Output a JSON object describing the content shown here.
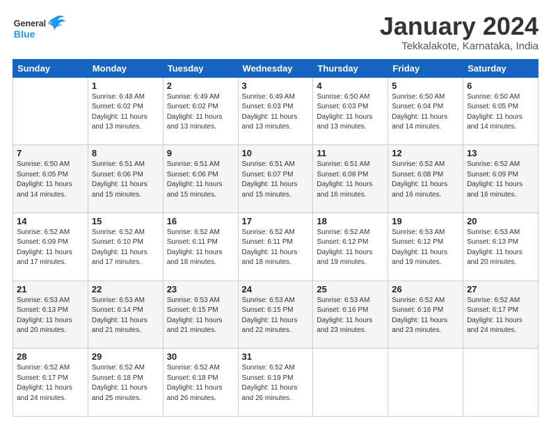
{
  "header": {
    "logo_general": "General",
    "logo_blue": "Blue",
    "month_title": "January 2024",
    "location": "Tekkalakote, Karnataka, India"
  },
  "weekdays": [
    "Sunday",
    "Monday",
    "Tuesday",
    "Wednesday",
    "Thursday",
    "Friday",
    "Saturday"
  ],
  "weeks": [
    [
      {
        "day": "",
        "sunrise": "",
        "sunset": "",
        "daylight": ""
      },
      {
        "day": "1",
        "sunrise": "Sunrise: 6:48 AM",
        "sunset": "Sunset: 6:02 PM",
        "daylight": "Daylight: 11 hours and 13 minutes."
      },
      {
        "day": "2",
        "sunrise": "Sunrise: 6:49 AM",
        "sunset": "Sunset: 6:02 PM",
        "daylight": "Daylight: 11 hours and 13 minutes."
      },
      {
        "day": "3",
        "sunrise": "Sunrise: 6:49 AM",
        "sunset": "Sunset: 6:03 PM",
        "daylight": "Daylight: 11 hours and 13 minutes."
      },
      {
        "day": "4",
        "sunrise": "Sunrise: 6:50 AM",
        "sunset": "Sunset: 6:03 PM",
        "daylight": "Daylight: 11 hours and 13 minutes."
      },
      {
        "day": "5",
        "sunrise": "Sunrise: 6:50 AM",
        "sunset": "Sunset: 6:04 PM",
        "daylight": "Daylight: 11 hours and 14 minutes."
      },
      {
        "day": "6",
        "sunrise": "Sunrise: 6:50 AM",
        "sunset": "Sunset: 6:05 PM",
        "daylight": "Daylight: 11 hours and 14 minutes."
      }
    ],
    [
      {
        "day": "7",
        "sunrise": "Sunrise: 6:50 AM",
        "sunset": "Sunset: 6:05 PM",
        "daylight": "Daylight: 11 hours and 14 minutes."
      },
      {
        "day": "8",
        "sunrise": "Sunrise: 6:51 AM",
        "sunset": "Sunset: 6:06 PM",
        "daylight": "Daylight: 11 hours and 15 minutes."
      },
      {
        "day": "9",
        "sunrise": "Sunrise: 6:51 AM",
        "sunset": "Sunset: 6:06 PM",
        "daylight": "Daylight: 11 hours and 15 minutes."
      },
      {
        "day": "10",
        "sunrise": "Sunrise: 6:51 AM",
        "sunset": "Sunset: 6:07 PM",
        "daylight": "Daylight: 11 hours and 15 minutes."
      },
      {
        "day": "11",
        "sunrise": "Sunrise: 6:51 AM",
        "sunset": "Sunset: 6:08 PM",
        "daylight": "Daylight: 11 hours and 16 minutes."
      },
      {
        "day": "12",
        "sunrise": "Sunrise: 6:52 AM",
        "sunset": "Sunset: 6:08 PM",
        "daylight": "Daylight: 11 hours and 16 minutes."
      },
      {
        "day": "13",
        "sunrise": "Sunrise: 6:52 AM",
        "sunset": "Sunset: 6:09 PM",
        "daylight": "Daylight: 11 hours and 16 minutes."
      }
    ],
    [
      {
        "day": "14",
        "sunrise": "Sunrise: 6:52 AM",
        "sunset": "Sunset: 6:09 PM",
        "daylight": "Daylight: 11 hours and 17 minutes."
      },
      {
        "day": "15",
        "sunrise": "Sunrise: 6:52 AM",
        "sunset": "Sunset: 6:10 PM",
        "daylight": "Daylight: 11 hours and 17 minutes."
      },
      {
        "day": "16",
        "sunrise": "Sunrise: 6:52 AM",
        "sunset": "Sunset: 6:11 PM",
        "daylight": "Daylight: 11 hours and 18 minutes."
      },
      {
        "day": "17",
        "sunrise": "Sunrise: 6:52 AM",
        "sunset": "Sunset: 6:11 PM",
        "daylight": "Daylight: 11 hours and 18 minutes."
      },
      {
        "day": "18",
        "sunrise": "Sunrise: 6:52 AM",
        "sunset": "Sunset: 6:12 PM",
        "daylight": "Daylight: 11 hours and 19 minutes."
      },
      {
        "day": "19",
        "sunrise": "Sunrise: 6:53 AM",
        "sunset": "Sunset: 6:12 PM",
        "daylight": "Daylight: 11 hours and 19 minutes."
      },
      {
        "day": "20",
        "sunrise": "Sunrise: 6:53 AM",
        "sunset": "Sunset: 6:13 PM",
        "daylight": "Daylight: 11 hours and 20 minutes."
      }
    ],
    [
      {
        "day": "21",
        "sunrise": "Sunrise: 6:53 AM",
        "sunset": "Sunset: 6:13 PM",
        "daylight": "Daylight: 11 hours and 20 minutes."
      },
      {
        "day": "22",
        "sunrise": "Sunrise: 6:53 AM",
        "sunset": "Sunset: 6:14 PM",
        "daylight": "Daylight: 11 hours and 21 minutes."
      },
      {
        "day": "23",
        "sunrise": "Sunrise: 6:53 AM",
        "sunset": "Sunset: 6:15 PM",
        "daylight": "Daylight: 11 hours and 21 minutes."
      },
      {
        "day": "24",
        "sunrise": "Sunrise: 6:53 AM",
        "sunset": "Sunset: 6:15 PM",
        "daylight": "Daylight: 11 hours and 22 minutes."
      },
      {
        "day": "25",
        "sunrise": "Sunrise: 6:53 AM",
        "sunset": "Sunset: 6:16 PM",
        "daylight": "Daylight: 11 hours and 23 minutes."
      },
      {
        "day": "26",
        "sunrise": "Sunrise: 6:52 AM",
        "sunset": "Sunset: 6:16 PM",
        "daylight": "Daylight: 11 hours and 23 minutes."
      },
      {
        "day": "27",
        "sunrise": "Sunrise: 6:52 AM",
        "sunset": "Sunset: 6:17 PM",
        "daylight": "Daylight: 11 hours and 24 minutes."
      }
    ],
    [
      {
        "day": "28",
        "sunrise": "Sunrise: 6:52 AM",
        "sunset": "Sunset: 6:17 PM",
        "daylight": "Daylight: 11 hours and 24 minutes."
      },
      {
        "day": "29",
        "sunrise": "Sunrise: 6:52 AM",
        "sunset": "Sunset: 6:18 PM",
        "daylight": "Daylight: 11 hours and 25 minutes."
      },
      {
        "day": "30",
        "sunrise": "Sunrise: 6:52 AM",
        "sunset": "Sunset: 6:18 PM",
        "daylight": "Daylight: 11 hours and 26 minutes."
      },
      {
        "day": "31",
        "sunrise": "Sunrise: 6:52 AM",
        "sunset": "Sunset: 6:19 PM",
        "daylight": "Daylight: 11 hours and 26 minutes."
      },
      {
        "day": "",
        "sunrise": "",
        "sunset": "",
        "daylight": ""
      },
      {
        "day": "",
        "sunrise": "",
        "sunset": "",
        "daylight": ""
      },
      {
        "day": "",
        "sunrise": "",
        "sunset": "",
        "daylight": ""
      }
    ]
  ]
}
